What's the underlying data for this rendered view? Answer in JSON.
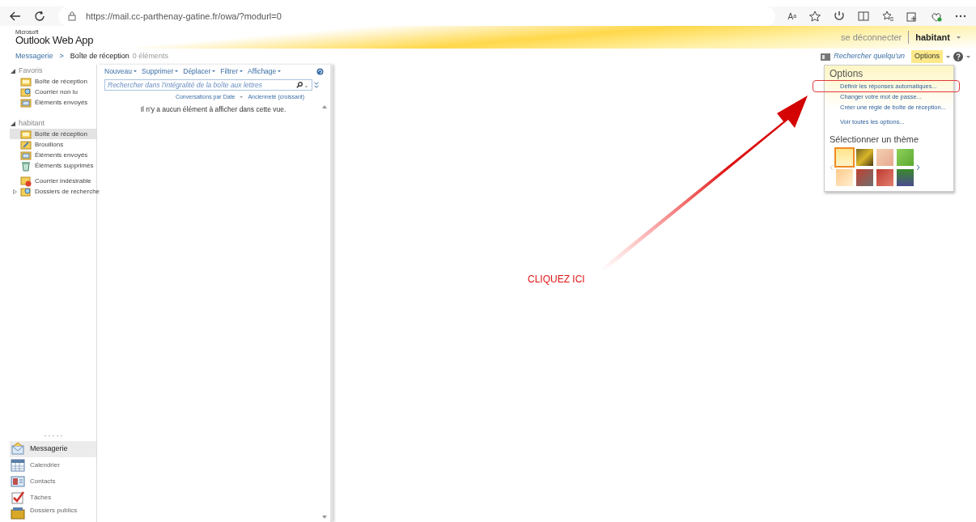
{
  "browser": {
    "url": "https://mail.cc-parthenay-gatine.fr/owa/?modurl=0",
    "reader_label": "Aᵃ"
  },
  "header": {
    "logo_small": "Microsoft",
    "logo": "Outlook Web App",
    "signout": "se déconnecter",
    "user": "habitant"
  },
  "breadcrumb": {
    "root": "Messagerie",
    "separator": ">",
    "folder": "Boîte de réception",
    "count": "0 éléments"
  },
  "top_links": {
    "find_person": "Rechercher quelqu'un",
    "options": "Options",
    "options_open": true
  },
  "folders": [
    {
      "label": "Favoris",
      "expanded": true,
      "children": [
        {
          "label": "Boîte de réception",
          "kind": "inbox",
          "selected": false
        },
        {
          "label": "Courrier non lu",
          "kind": "search",
          "selected": false
        },
        {
          "label": "Éléments envoyés",
          "kind": "sent",
          "selected": false
        }
      ]
    },
    {
      "label": "habitant",
      "expanded": true,
      "children": [
        {
          "label": "Boîte de réception",
          "kind": "inbox",
          "selected": true
        },
        {
          "label": "Brouillons",
          "kind": "drafts",
          "selected": false
        },
        {
          "label": "Éléments envoyés",
          "kind": "sent",
          "selected": false
        },
        {
          "label": "Éléments supprimés",
          "kind": "trash",
          "selected": false
        },
        {
          "label": "Courrier indésirable",
          "kind": "junk",
          "selected": false,
          "gap": true
        },
        {
          "label": "Dossiers de recherche",
          "kind": "search",
          "selected": false,
          "expanded": false
        }
      ]
    }
  ],
  "modules": [
    {
      "label": "Messagerie",
      "kind": "mail",
      "selected": true
    },
    {
      "label": "Calendrier",
      "kind": "calendar",
      "selected": false
    },
    {
      "label": "Contacts",
      "kind": "contacts",
      "selected": false
    },
    {
      "label": "Tâches",
      "kind": "tasks",
      "selected": false
    },
    {
      "label": "Dossiers publics",
      "kind": "public",
      "selected": false
    }
  ],
  "toolbar": [
    "Nouveau",
    "Supprimer",
    "Déplacer",
    "Filtrer",
    "Affichage"
  ],
  "search": {
    "placeholder": "Rechercher dans l'intégralité de la boîte aux lettres"
  },
  "sort": {
    "arrange": "Conversations par Date",
    "order": "Ancienneté (croissant)"
  },
  "empty_message": "Il n'y a aucun élément à afficher dans cette vue.",
  "options_menu": {
    "title": "Options",
    "items": [
      {
        "label": "Définir les réponses automatiques...",
        "highlighted": true
      },
      {
        "label": "Changer votre mot de passe...",
        "highlighted": false
      },
      {
        "label": "Créer une règle de boîte de réception...",
        "highlighted": false
      },
      {
        "label": "Voir toutes les options...",
        "highlighted": false
      }
    ],
    "theme_title": "Sélectionner un thème",
    "themes": [
      {
        "selected": true
      },
      {
        "selected": false
      },
      {
        "selected": false
      },
      {
        "selected": false
      },
      {
        "selected": false
      },
      {
        "selected": false
      },
      {
        "selected": false
      },
      {
        "selected": false
      }
    ]
  },
  "annotation": {
    "text": "CLIQUEZ ICI"
  }
}
